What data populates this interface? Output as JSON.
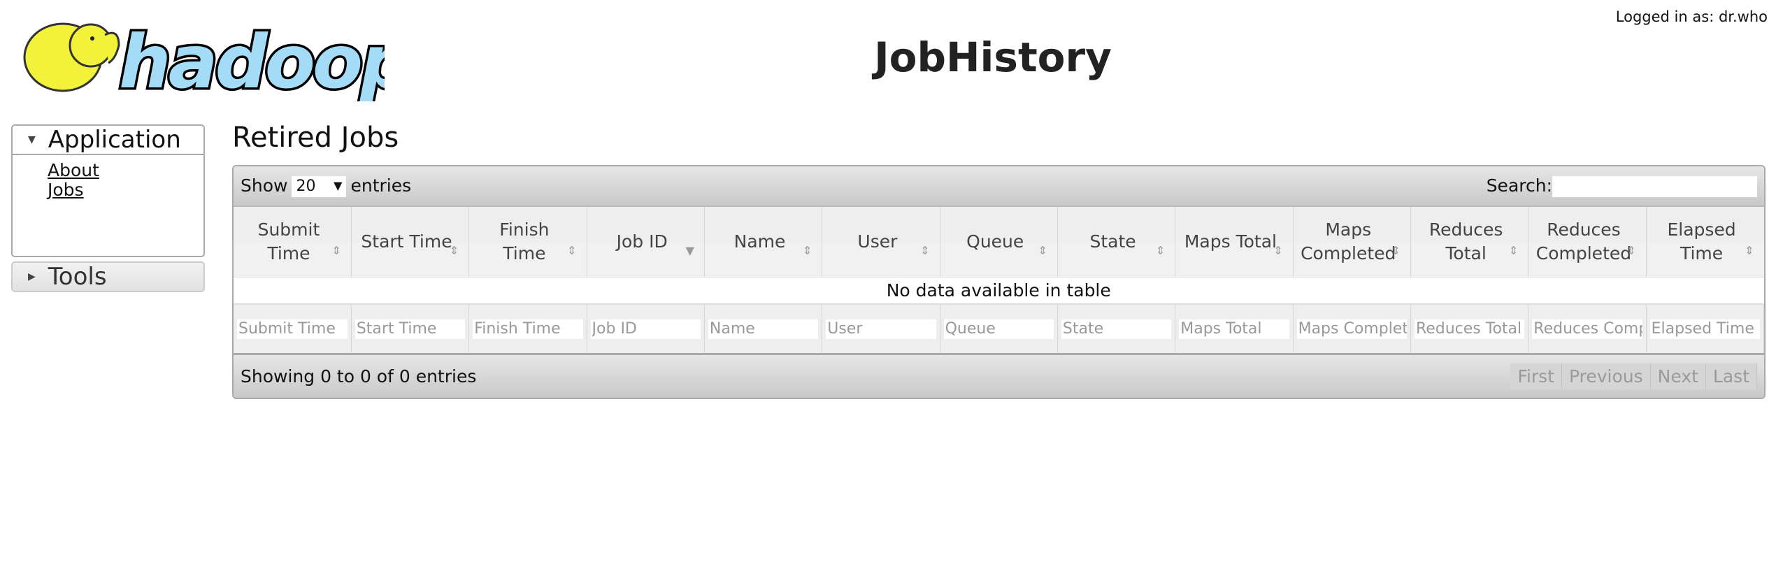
{
  "header": {
    "logo_text": "hadoop",
    "title": "JobHistory",
    "logged_in": "Logged in as: dr.who"
  },
  "sidebar": {
    "application": {
      "label": "Application",
      "items": [
        {
          "label": "About"
        },
        {
          "label": "Jobs"
        }
      ]
    },
    "tools": {
      "label": "Tools"
    }
  },
  "main": {
    "heading": "Retired Jobs",
    "toolbar": {
      "show_label": "Show",
      "page_size": "20",
      "entries_label": "entries",
      "search_label": "Search:",
      "search_value": ""
    },
    "columns": [
      {
        "label": "Submit Time",
        "sort": "both"
      },
      {
        "label": "Start Time",
        "sort": "both"
      },
      {
        "label": "Finish Time",
        "sort": "both"
      },
      {
        "label": "Job ID",
        "sort": "desc"
      },
      {
        "label": "Name",
        "sort": "both"
      },
      {
        "label": "User",
        "sort": "both"
      },
      {
        "label": "Queue",
        "sort": "both"
      },
      {
        "label": "State",
        "sort": "both"
      },
      {
        "label": "Maps Total",
        "sort": "both"
      },
      {
        "label": "Maps Completed",
        "sort": "both"
      },
      {
        "label": "Reduces Total",
        "sort": "both"
      },
      {
        "label": "Reduces Completed",
        "sort": "both"
      },
      {
        "label": "Elapsed Time",
        "sort": "both"
      }
    ],
    "empty_message": "No data available in table",
    "filters": [
      "Submit Time",
      "Start Time",
      "Finish Time",
      "Job ID",
      "Name",
      "User",
      "Queue",
      "State",
      "Maps Total",
      "Maps Completed",
      "Reduces Total",
      "Reduces Completed",
      "Elapsed Time"
    ],
    "footer": {
      "info": "Showing 0 to 0 of 0 entries",
      "pagination": [
        "First",
        "Previous",
        "Next",
        "Last"
      ]
    }
  }
}
